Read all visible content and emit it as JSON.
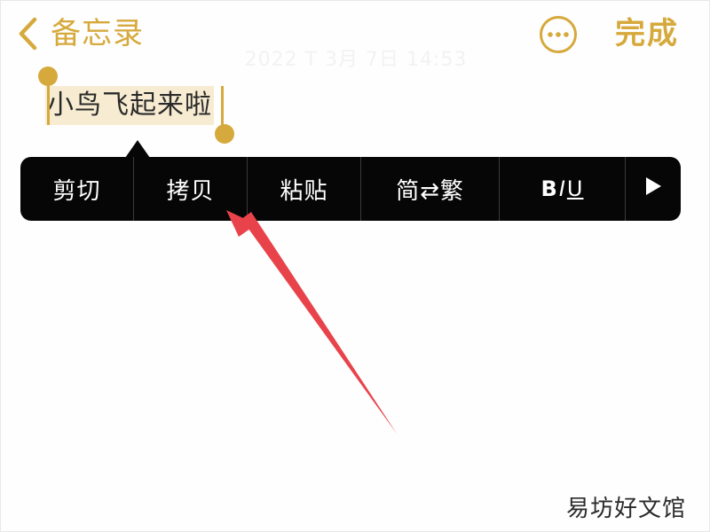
{
  "nav": {
    "back_label": "备忘录",
    "done_label": "完成"
  },
  "note": {
    "date": "2022 T 3月 7日 14:53",
    "selected_text": "小鸟飞起来啦"
  },
  "edit_menu": {
    "items": [
      "剪切",
      "拷贝",
      "粘贴",
      "简⇄繁"
    ],
    "format": {
      "b": "B",
      "i": "I",
      "u": "U"
    }
  },
  "annotation": {
    "color": "#e8434a",
    "target": "拷贝"
  },
  "watermark": "易坊好文馆",
  "colors": {
    "accent": "#d6a93c",
    "menu_bg": "#060606",
    "selection": "#f7ecd2"
  },
  "icons": {
    "back": "chevron-left-icon",
    "more": "ellipsis-circle-icon",
    "next": "play-triangle-icon"
  }
}
